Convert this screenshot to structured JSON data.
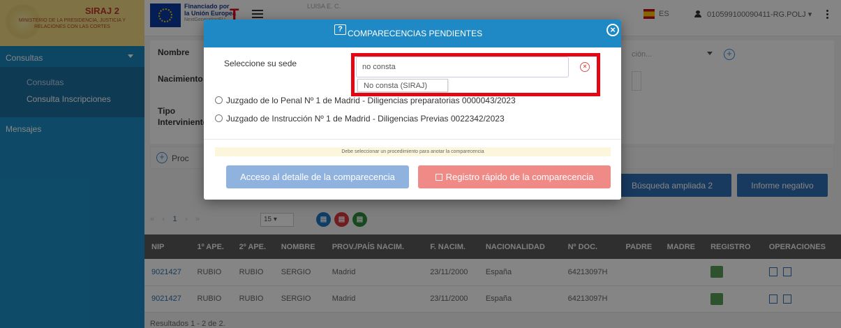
{
  "app": {
    "name": "SIRAJ 2",
    "ministry": "MINISTERIO DE LA PRESIDENCIA, JUSTICIA Y RELACIONES CON LAS CORTES"
  },
  "sidebar": {
    "sections": [
      {
        "label": "Consultas"
      },
      {
        "label": "Mensajes"
      }
    ],
    "items": [
      {
        "label": "Consultas"
      },
      {
        "label": "Consulta Inscripciones"
      }
    ]
  },
  "topbar": {
    "funded_line1": "Financiado por",
    "funded_line2": "la Unión Europea",
    "funded_line3": "NextGenerationEU",
    "subject": "LUISA E. C.",
    "lang": "ES",
    "user": "010599100090411-RG.POLJ"
  },
  "form": {
    "nombre_label": "Nombre",
    "nacimiento_label": "Nacimiento",
    "tipo_label": "Tipo",
    "interviniente_label": "Interviniente",
    "select_placeholder": "ción...",
    "proc_label": "Proc"
  },
  "buttons": {
    "busqueda": "Búsqueda ampliada 2",
    "informe": "Informe negativo"
  },
  "pager": {
    "first": "«",
    "prev": "‹",
    "page": "1",
    "next": "›",
    "last": "»",
    "size": "15"
  },
  "table": {
    "headers": [
      "NIP",
      "1º APE.",
      "2º APE.",
      "NOMBRE",
      "PROV./PAÍS NACIM.",
      "F. NACIM.",
      "NACIONALIDAD",
      "Nº DOC.",
      "PADRE",
      "MADRE",
      "REGISTRO",
      "OPERACIONES"
    ],
    "rows": [
      {
        "nip": "9021427",
        "ape1": "RUBIO",
        "ape2": "RUBIO",
        "nombre": "SERGIO",
        "prov": "Madrid",
        "fnac": "23/11/2000",
        "nac": "España",
        "doc": "64213097H"
      },
      {
        "nip": "9021427",
        "ape1": "RUBIO",
        "ape2": "RUBIO",
        "nombre": "SERGIO",
        "prov": "Madrid",
        "fnac": "23/11/2000",
        "nac": "España",
        "doc": "64213097H"
      }
    ],
    "results": "Resultados 1 - 2 de 2."
  },
  "modal": {
    "title": "COMPARECENCIAS PENDIENTES",
    "sede_label": "Seleccione su sede",
    "sede_value": "no consta",
    "suggestion": "No consta (SIRAJ)",
    "options": [
      "Juzgado de lo Penal Nº 1 de Madrid - Diligencias preparatorias 0000043/2023",
      "Juzgado de Instrucción Nº 1 de Madrid - Diligencias Previas 0022342/2023"
    ],
    "warning": "Debe seleccionar un procedimiento para anotar la comparecencia",
    "detail_button": "Acceso al detalle de la comparecencia",
    "quick_button": "Registro rápido de la comparecencia"
  },
  "colors": {
    "sidebar": "#1b8fc7",
    "header": "#1e89c5",
    "primary_button": "#2f70b6",
    "highlight_frame": "#e30613"
  }
}
